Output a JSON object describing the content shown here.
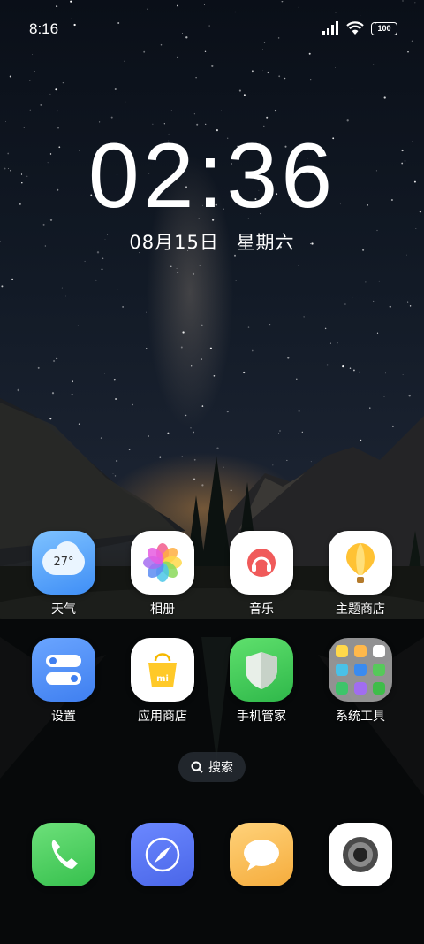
{
  "status_bar": {
    "time": "8:16",
    "battery": "100",
    "icons": [
      "signal-icon",
      "wifi-icon",
      "battery-icon"
    ]
  },
  "clock": {
    "time": "02:36",
    "date": "08月15日",
    "weekday": "星期六"
  },
  "apps": [
    {
      "name": "天气",
      "icon": "weather-icon",
      "badge_text": "27°"
    },
    {
      "name": "相册",
      "icon": "gallery-icon"
    },
    {
      "name": "音乐",
      "icon": "music-icon"
    },
    {
      "name": "主题商店",
      "icon": "theme-store-icon"
    },
    {
      "name": "设置",
      "icon": "settings-icon"
    },
    {
      "name": "应用商店",
      "icon": "app-store-icon",
      "badge_text": "mi"
    },
    {
      "name": "手机管家",
      "icon": "security-icon"
    },
    {
      "name": "系统工具",
      "icon": "system-tools-folder-icon"
    }
  ],
  "search": {
    "label": "搜索"
  },
  "dock": [
    {
      "icon": "phone-icon",
      "color": "#4cd964"
    },
    {
      "icon": "browser-icon",
      "color": "#4f74f0"
    },
    {
      "icon": "messages-icon",
      "color": "#f6b24a"
    },
    {
      "icon": "camera-icon",
      "color": "#ffffff"
    }
  ]
}
